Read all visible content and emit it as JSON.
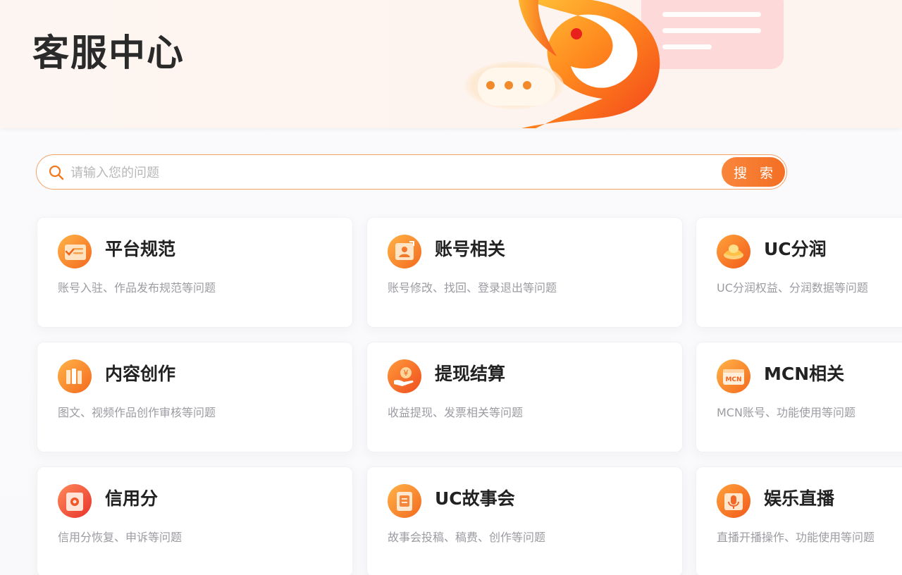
{
  "header": {
    "title": "客服中心"
  },
  "search": {
    "placeholder": "请输入您的问题",
    "value": "",
    "button_label": "搜 索"
  },
  "categories": [
    {
      "title": "平台规范",
      "desc": "账号入驻、作品发布规范等问题",
      "icon": "document-icon"
    },
    {
      "title": "账号相关",
      "desc": "账号修改、找回、登录退出等问题",
      "icon": "account-icon"
    },
    {
      "title": "UC分润",
      "desc": "UC分润权益、分润数据等问题",
      "icon": "gold-ingot-icon"
    },
    {
      "title": "内容创作",
      "desc": "图文、视频作品创作审核等问题",
      "icon": "books-icon"
    },
    {
      "title": "提现结算",
      "desc": "收益提现、发票相关等问题",
      "icon": "yuan-coin-hand-icon"
    },
    {
      "title": "MCN相关",
      "desc": "MCN账号、功能使用等问题",
      "icon": "mcn-icon"
    },
    {
      "title": "信用分",
      "desc": "信用分恢复、申诉等问题",
      "icon": "credit-icon"
    },
    {
      "title": "UC故事会",
      "desc": "故事会投稿、稿费、创作等问题",
      "icon": "story-book-icon"
    },
    {
      "title": "娱乐直播",
      "desc": "直播开播操作、功能使用等问题",
      "icon": "microphone-icon"
    }
  ],
  "colors": {
    "accent": "#f3772c",
    "accent_light": "#f9a24a",
    "title_text": "#222222",
    "desc_text": "#9b9ba2",
    "header_bg": "#fdf4f0"
  }
}
